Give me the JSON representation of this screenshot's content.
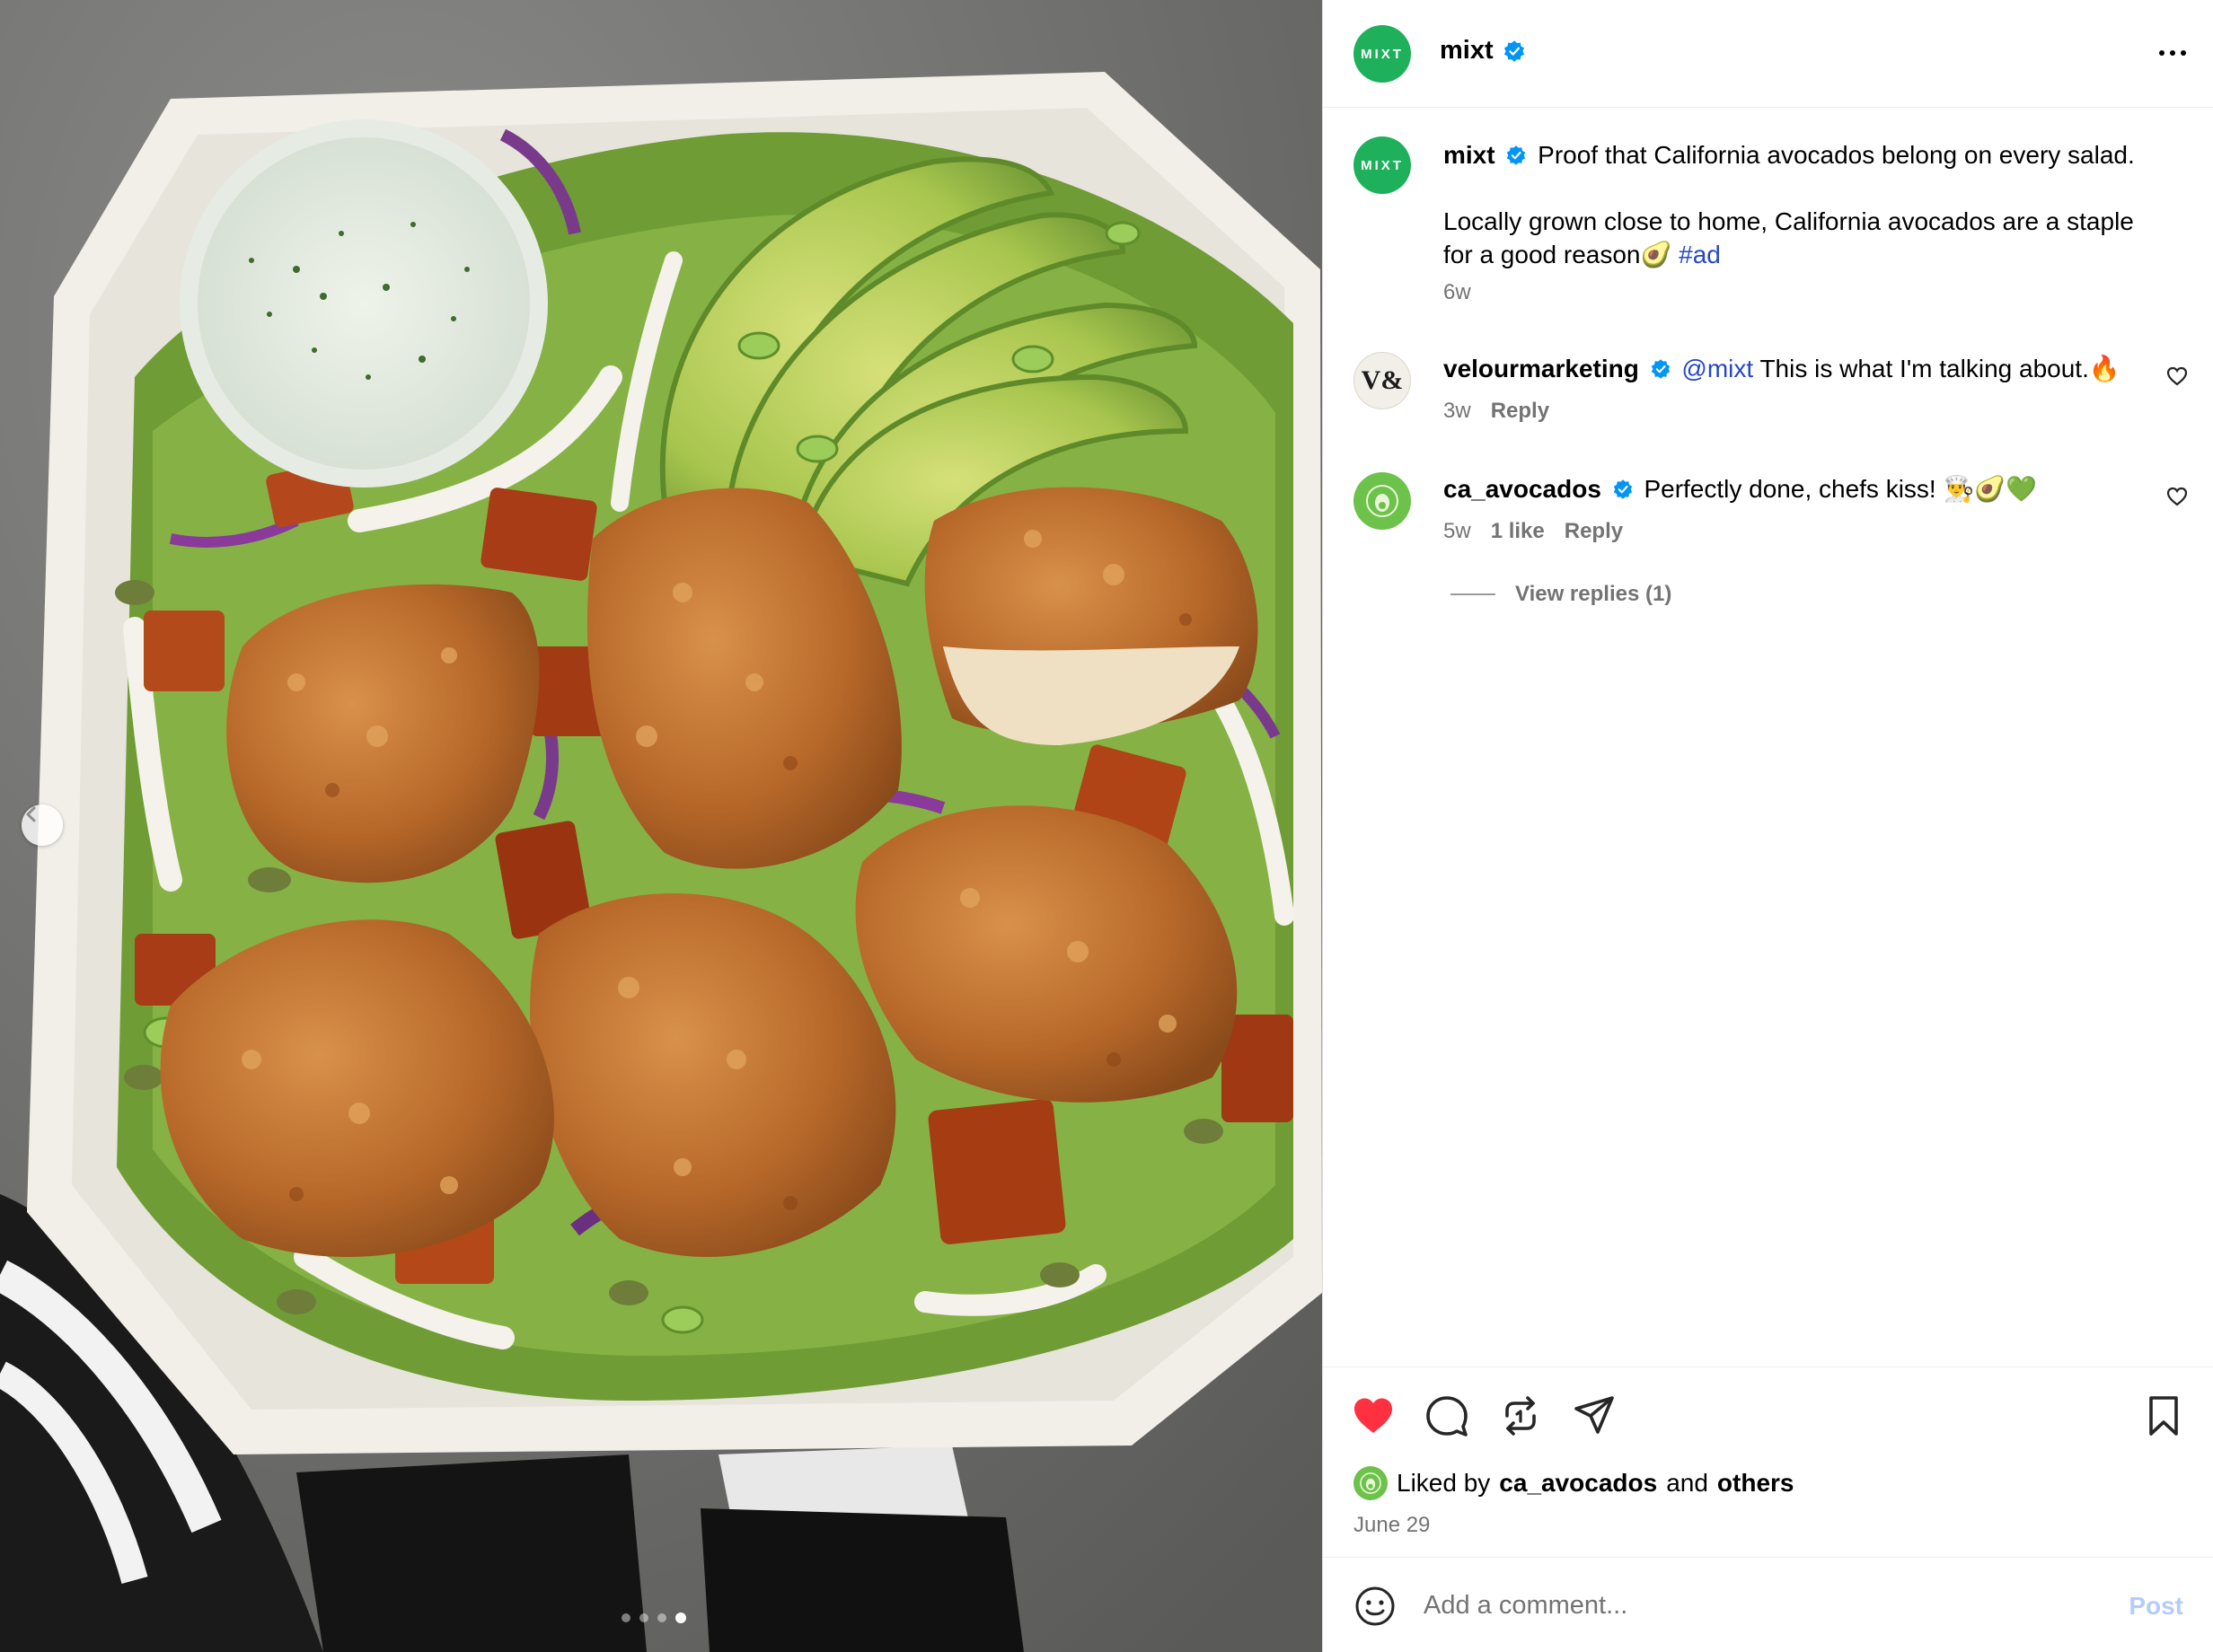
{
  "post": {
    "author": "mixt",
    "author_avatar_text": "MIXT",
    "verified": true
  },
  "caption": {
    "username": "mixt",
    "line1": "Proof that California avocados belong on every salad.",
    "line2": "Locally grown close to home, California avocados are a staple for a good reason🥑",
    "hashtag": "#ad",
    "age": "6w"
  },
  "comments": [
    {
      "username": "velourmarketing",
      "avatar_text": "V&",
      "mention": "@mixt",
      "text": "This is what I'm talking about.🔥",
      "age": "3w",
      "likes": "",
      "reply_label": "Reply"
    },
    {
      "username": "ca_avocados",
      "mention": "",
      "text": "Perfectly done, chefs kiss! 👨‍🍳🥑💚",
      "age": "5w",
      "likes": "1 like",
      "reply_label": "Reply",
      "view_replies": "View replies (1)"
    }
  ],
  "likes": {
    "prefix": "Liked by",
    "user": "ca_avocados",
    "joiner": "and",
    "others": "others",
    "date": "June 29"
  },
  "composer": {
    "placeholder": "Add a comment...",
    "post_label": "Post"
  },
  "carousel": {
    "total": 4,
    "active": 4
  },
  "colors": {
    "brand_green": "#1fb05b",
    "like_red": "#ff3040",
    "link_blue": "#2547c6",
    "verified_blue": "#0095f6",
    "post_disabled": "#b3cdfa"
  }
}
